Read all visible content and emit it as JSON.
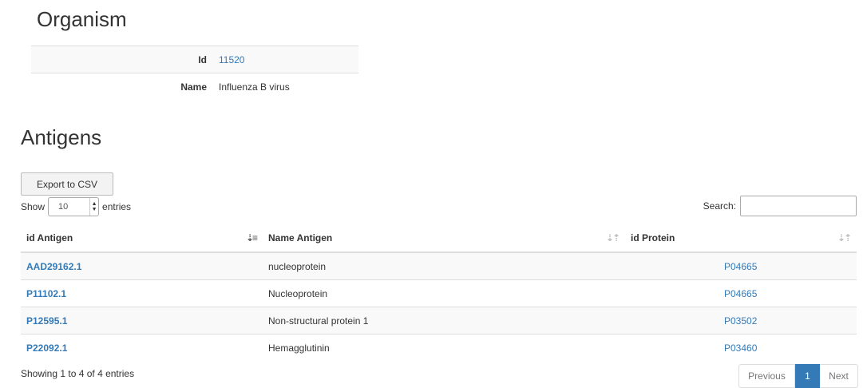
{
  "organism": {
    "heading": "Organism",
    "rows": [
      {
        "label": "Id",
        "value": "11520"
      },
      {
        "label": "Name",
        "value": "Influenza B virus"
      }
    ]
  },
  "antigens": {
    "heading": "Antigens",
    "export_label": "Export to CSV",
    "length": {
      "show_label": "Show",
      "selected": "10",
      "entries_label": "entries"
    },
    "search": {
      "label": "Search:",
      "value": ""
    },
    "columns": [
      "id Antigen",
      "Name Antigen",
      "id Protein"
    ],
    "rows": [
      {
        "id": "AAD29162.1",
        "name": "nucleoprotein",
        "protein": "P04665"
      },
      {
        "id": "P11102.1",
        "name": "Nucleoprotein",
        "protein": "P04665"
      },
      {
        "id": "P12595.1",
        "name": "Non-structural protein 1",
        "protein": "P03502"
      },
      {
        "id": "P22092.1",
        "name": "Hemagglutinin",
        "protein": "P03460"
      }
    ],
    "info": "Showing 1 to 4 of 4 entries",
    "pagination": {
      "previous": "Previous",
      "current": "1",
      "next": "Next"
    }
  },
  "icons": {
    "sort_active": "sort-amount-down-icon",
    "sort_inactive": "sort-both-icon",
    "select_arrow": "spinner-arrows-icon"
  },
  "colors": {
    "link": "#337ab7",
    "active_page": "#337ab7"
  }
}
